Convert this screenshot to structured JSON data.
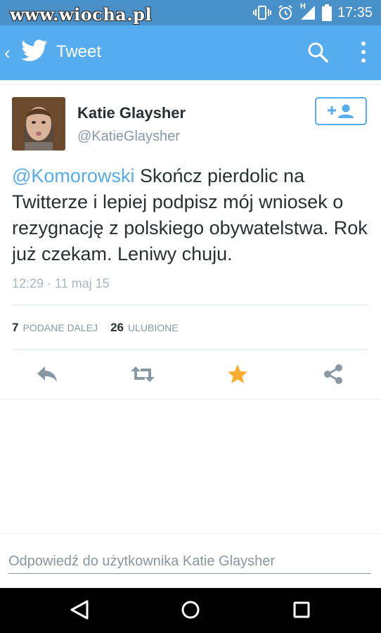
{
  "status_bar": {
    "watermark": "www.wiocha.pl",
    "network_label": "H",
    "time": "17:35"
  },
  "app_bar": {
    "title": "Tweet",
    "icons": [
      "back-chevron-icon",
      "twitter-bird-icon",
      "search-icon",
      "more-vert-icon"
    ]
  },
  "tweet": {
    "author_name": "Katie Glaysher",
    "author_handle": "@KatieGlaysher",
    "mention": "@Komorowski",
    "body": " Skończ pierdolic na Twitterze i lepiej podpisz mój wniosek o rezygnację z polskiego obywatelstwa. Rok już czekam. Leniwy chuju.",
    "timestamp": "12:29 · 11 maj 15",
    "retweets_count": "7",
    "retweets_label": "PODANE DALEJ",
    "favorites_count": "26",
    "favorites_label": "ULUBIONE"
  },
  "actions": [
    "reply-icon",
    "retweet-icon",
    "favorite-star-icon",
    "share-icon"
  ],
  "colors": {
    "brand_blue": "#55acee",
    "status_blue": "#4a90c8",
    "star_gold": "#ffac33",
    "action_gray": "#8899a6"
  },
  "reply": {
    "placeholder": "Odpowiedź do użytkownika Katie Glaysher"
  },
  "system_nav": [
    "nav-back-icon",
    "nav-home-icon",
    "nav-recents-icon"
  ]
}
